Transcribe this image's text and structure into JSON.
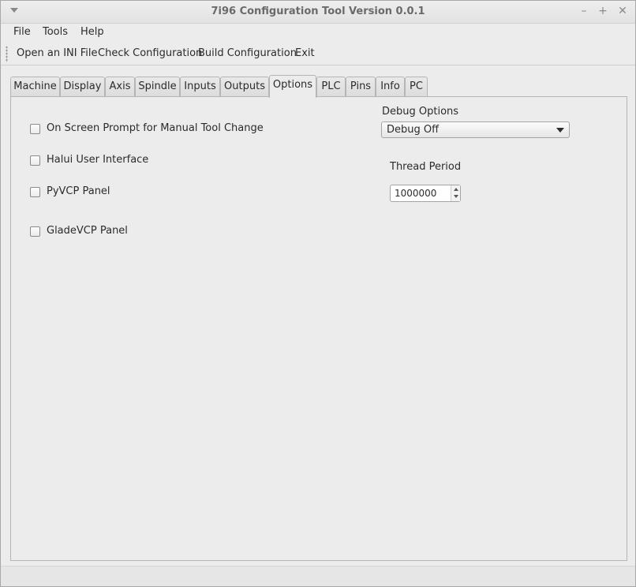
{
  "window": {
    "title": "7i96 Configuration Tool Version 0.0.1",
    "minimize_glyph": "–",
    "maximize_glyph": "+",
    "close_glyph": "✕"
  },
  "menubar": {
    "items": [
      {
        "label": "File"
      },
      {
        "label": "Tools"
      },
      {
        "label": "Help"
      }
    ]
  },
  "toolbar": {
    "open_label": "Open an INI File",
    "check_label": "Check Configuration",
    "build_label": "Build Configuration",
    "exit_label": "Exit"
  },
  "tabs": [
    {
      "label": "Machine"
    },
    {
      "label": "Display"
    },
    {
      "label": "Axis"
    },
    {
      "label": "Spindle"
    },
    {
      "label": "Inputs"
    },
    {
      "label": "Outputs"
    },
    {
      "label": "Options",
      "active": true
    },
    {
      "label": "PLC"
    },
    {
      "label": "Pins"
    },
    {
      "label": "Info"
    },
    {
      "label": "PC"
    }
  ],
  "options": {
    "checkboxes": [
      {
        "label": "On Screen Prompt for Manual Tool Change",
        "checked": false
      },
      {
        "label": "Halui User Interface",
        "checked": false
      },
      {
        "label": "PyVCP Panel",
        "checked": false
      },
      {
        "label": "GladeVCP Panel",
        "checked": false
      }
    ],
    "debug_options_label": "Debug Options",
    "debug_selected": "Debug Off",
    "thread_period_label": "Thread Period",
    "thread_period_value": "1000000"
  },
  "icons": {
    "window_menu": "chevron-down-icon",
    "combo_arrow": "chevron-down-icon",
    "spin_up": "arrow-up-icon",
    "spin_down": "arrow-down-icon"
  }
}
